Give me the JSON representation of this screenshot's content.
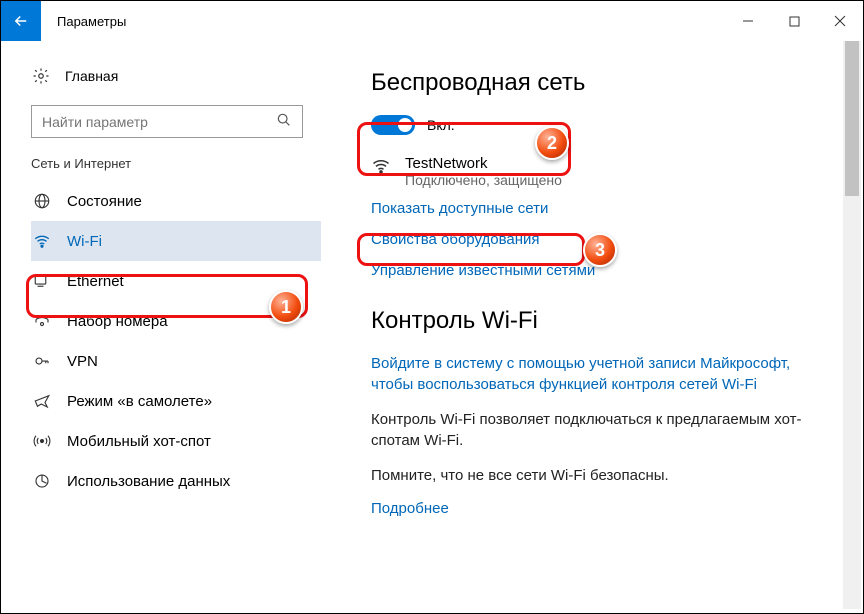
{
  "titlebar": {
    "title": "Параметры"
  },
  "sidebar": {
    "home": "Главная",
    "search_placeholder": "Найти параметр",
    "category": "Сеть и Интернет",
    "items": [
      {
        "label": "Состояние"
      },
      {
        "label": "Wi-Fi"
      },
      {
        "label": "Ethernet"
      },
      {
        "label": "Набор номера"
      },
      {
        "label": "VPN"
      },
      {
        "label": "Режим «в самолете»"
      },
      {
        "label": "Мобильный хот-спот"
      },
      {
        "label": "Использование данных"
      }
    ]
  },
  "main": {
    "section1_title": "Беспроводная сеть",
    "toggle_label": "Вкл.",
    "network": {
      "name": "TestNetwork",
      "status": "Подключено, защищено"
    },
    "link_show_networks": "Показать доступные сети",
    "link_hw_props": "Свойства оборудования",
    "link_known_nets": "Управление известными сетями",
    "section2_title": "Контроль Wi-Fi",
    "link_signin": "Войдите в систему с помощью учетной записи Майкрософт, чтобы воспользоваться функцией контроля сетей Wi-Fi",
    "body1": "Контроль Wi-Fi позволяет подключаться к предлагаемым хот-спотам Wi-Fi.",
    "body2": "Помните, что не все сети Wi-Fi безопасны.",
    "link_more": "Подробнее"
  },
  "annotations": {
    "b1": "1",
    "b2": "2",
    "b3": "3"
  }
}
